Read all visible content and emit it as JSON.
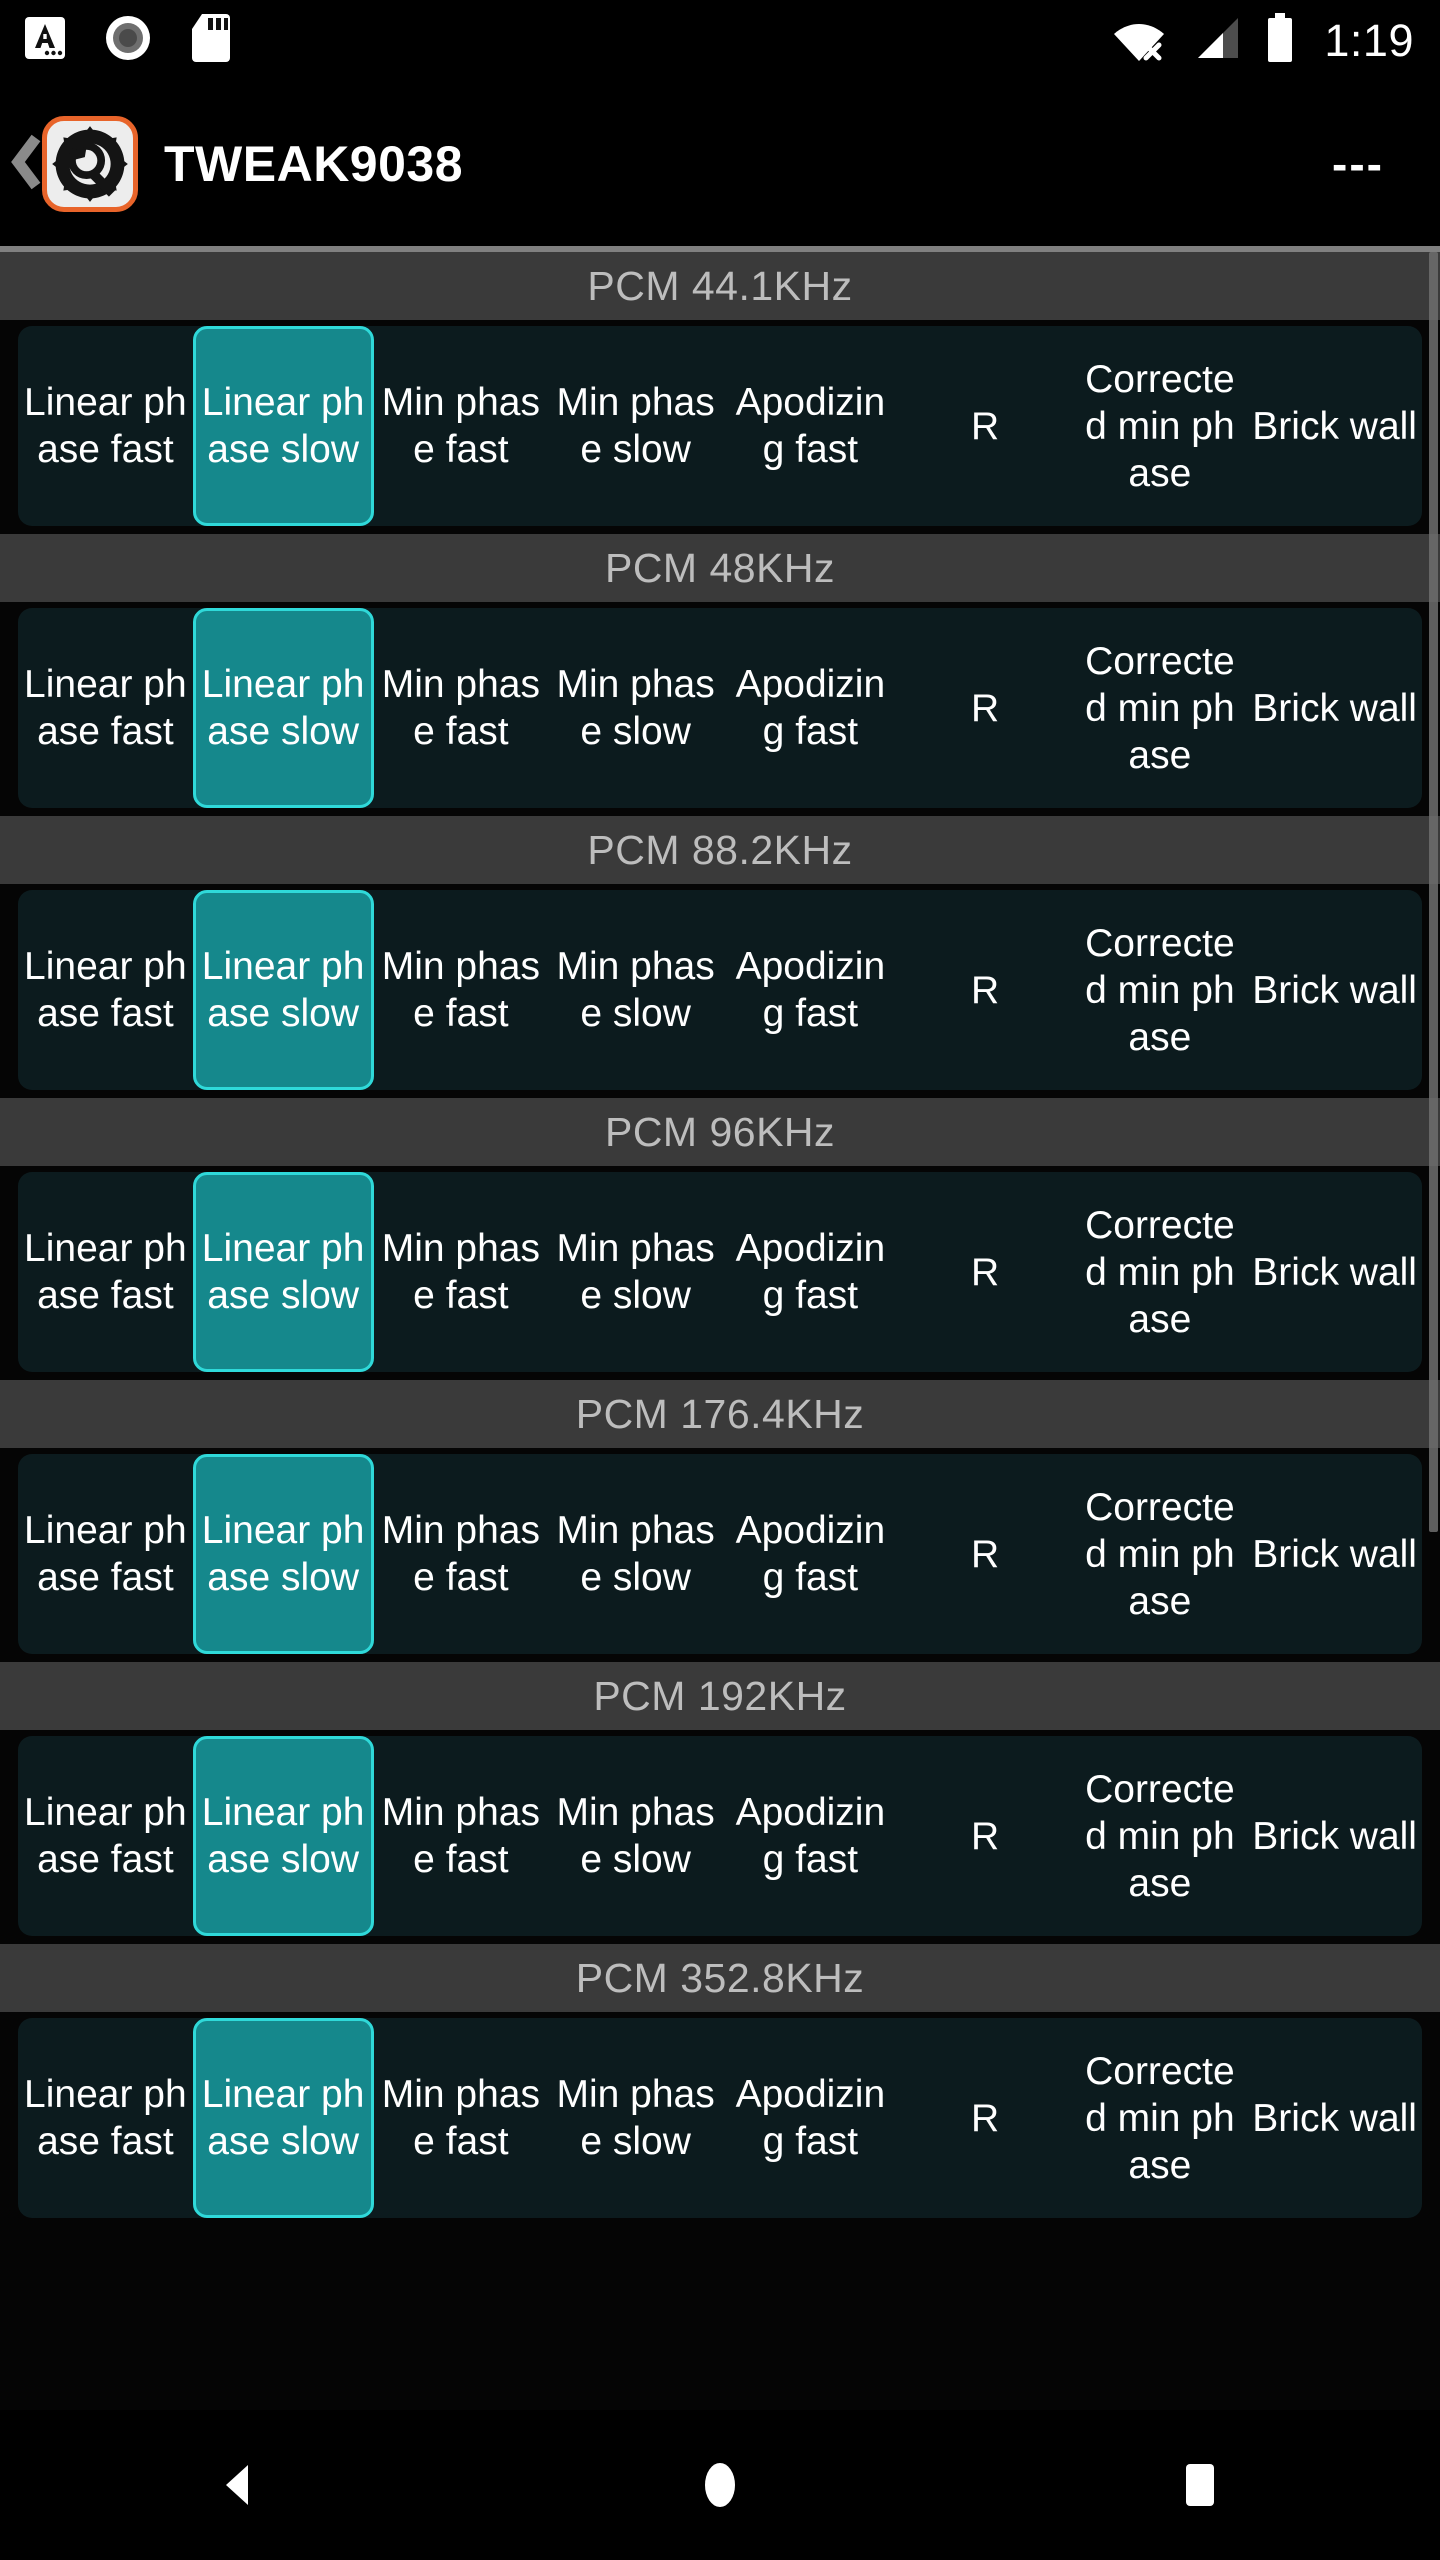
{
  "statusbar": {
    "icons": [
      "input-method-icon",
      "record-circle-icon",
      "sd-card-icon"
    ],
    "wifi_icon": "wifi-off-icon",
    "signal_icon": "cellular-signal-icon",
    "battery_icon": "battery-full-icon",
    "time": "1:19"
  },
  "appbar": {
    "back_icon": "back-chevron-icon",
    "app_icon": "gear-wrench-icon",
    "title": "TWEAK9038",
    "menu_label": "---"
  },
  "theme": {
    "accent": "#15888c",
    "accent_border": "#2fd9d9",
    "row_bg": "#0c1b1e",
    "header_bg": "#3a3a3a",
    "header_text": "#bdbdbd",
    "app_icon_border": "#e8642a",
    "page_bg": "#050505",
    "divider": "#808080"
  },
  "filters": [
    "Linear phase fast",
    "Linear phase slow",
    "Min phase fast",
    "Min phase slow",
    "Apodizing fast",
    "R",
    "Corrected min phase",
    "Brick wall"
  ],
  "sections": [
    {
      "title": "PCM 44.1KHz",
      "selected_index": 1
    },
    {
      "title": "PCM 48KHz",
      "selected_index": 1
    },
    {
      "title": "PCM 88.2KHz",
      "selected_index": 1
    },
    {
      "title": "PCM 96KHz",
      "selected_index": 1
    },
    {
      "title": "PCM 176.4KHz",
      "selected_index": 1
    },
    {
      "title": "PCM 192KHz",
      "selected_index": 1
    },
    {
      "title": "PCM 352.8KHz",
      "selected_index": 1
    }
  ],
  "navbar": {
    "back_label": "back-triangle-icon",
    "home_label": "home-circle-icon",
    "recents_label": "recents-square-icon"
  }
}
